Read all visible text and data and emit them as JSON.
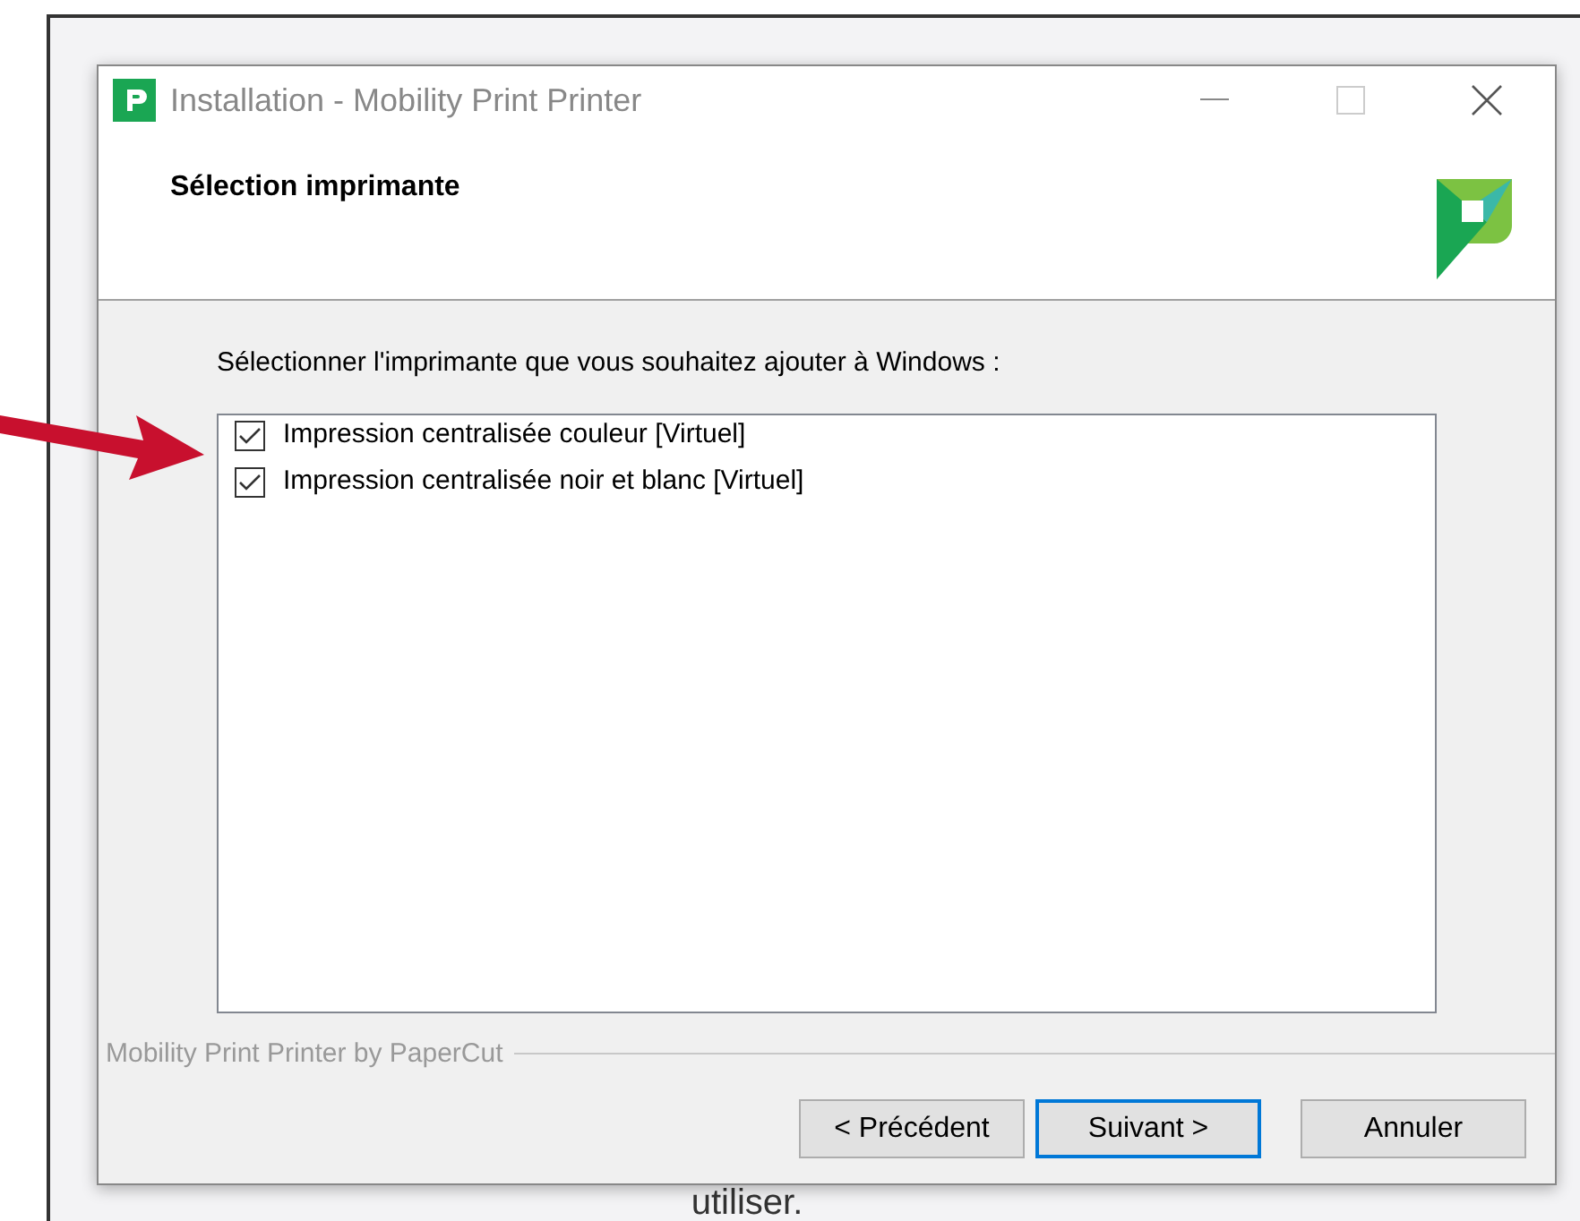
{
  "background": {
    "text": "utiliser."
  },
  "window": {
    "title": "Installation - Mobility Print Printer"
  },
  "header": {
    "title": "Sélection imprimante"
  },
  "instruction": "Sélectionner l'imprimante que vous souhaitez ajouter à Windows :",
  "printers": [
    {
      "label": "Impression centralisée couleur [Virtuel]",
      "checked": true
    },
    {
      "label": "Impression centralisée noir et blanc [Virtuel]",
      "checked": true
    }
  ],
  "footer": {
    "brand": "Mobility Print Printer by PaperCut"
  },
  "buttons": [
    {
      "label": "< Précédent",
      "default": false
    },
    {
      "label": "Suivant >",
      "default": true
    },
    {
      "label": "Annuler",
      "default": false
    }
  ]
}
